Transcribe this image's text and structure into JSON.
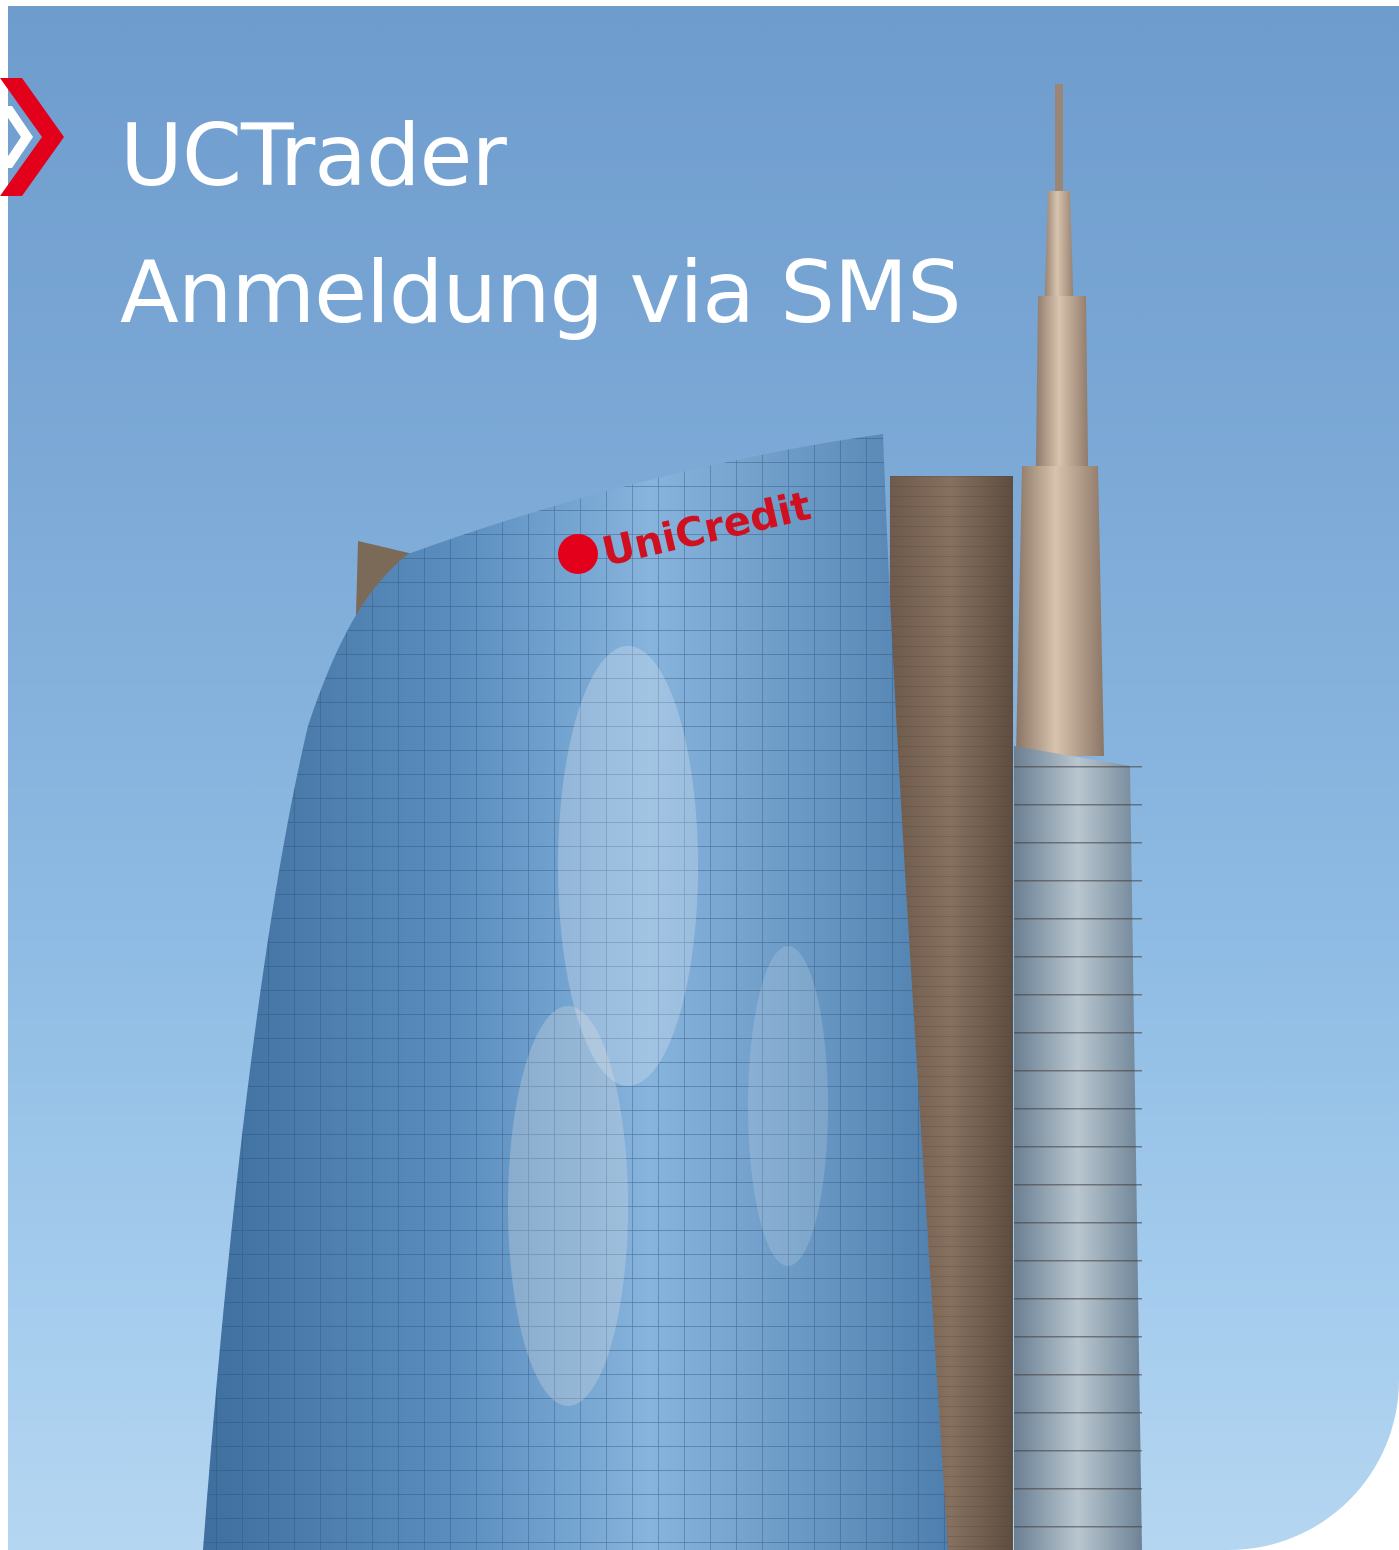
{
  "hero": {
    "title_line1": "UCTrader",
    "title_line2": "Anmeldung via SMS",
    "building_sign": "UniCredit",
    "image_description_icon": "building-photo"
  },
  "colors": {
    "brand_red": "#e2001a",
    "title_text": "#ffffff",
    "sky_top": "#6e9ccd",
    "sky_bottom": "#b5d6f1"
  },
  "icons": {
    "brand_mark": "chevron-arrow-icon"
  }
}
